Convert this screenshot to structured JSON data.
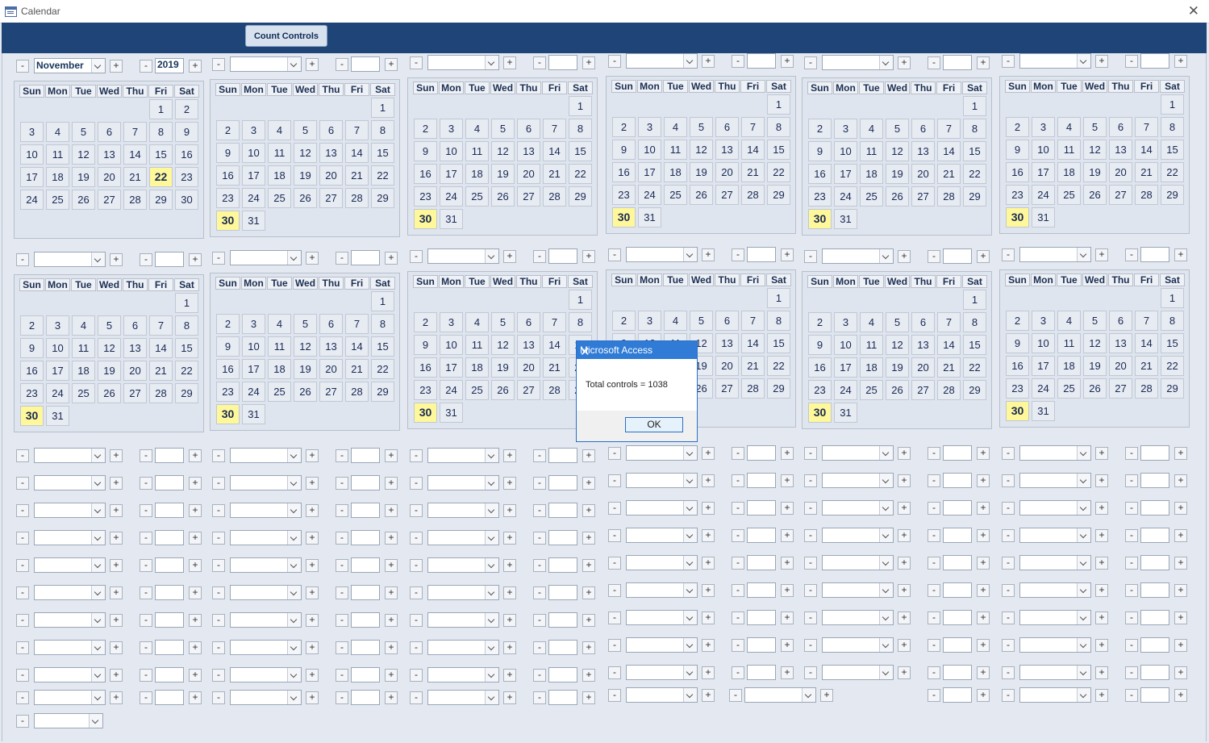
{
  "window": {
    "title": "Calendar",
    "close_glyph": "✕"
  },
  "toolbar": {
    "count_controls_label": "Count Controls"
  },
  "controls": {
    "minus_glyph": "-",
    "plus_glyph": "+"
  },
  "first_calendar": {
    "month": "November",
    "year": "2019",
    "today": "22"
  },
  "calendar": {
    "day_headers": [
      "Sun",
      "Mon",
      "Tue",
      "Wed",
      "Thu",
      "Fri",
      "Sat"
    ],
    "highlight_day": "30"
  },
  "calendars": [
    {
      "start": 5,
      "days": 30,
      "month": "November",
      "year": "2019",
      "today": 22
    },
    {
      "start": 6,
      "days": 31
    },
    {
      "start": 6,
      "days": 31
    },
    {
      "start": 6,
      "days": 31
    },
    {
      "start": 6,
      "days": 31
    },
    {
      "start": 6,
      "days": 31
    },
    {
      "start": 6,
      "days": 31
    },
    {
      "start": 6,
      "days": 31
    },
    {
      "start": 6,
      "days": 31
    },
    {
      "start": 6,
      "days": 31
    },
    {
      "start": 6,
      "days": 31
    },
    {
      "start": 6,
      "days": 31
    }
  ],
  "dialog": {
    "title": "Microsoft Access",
    "message": "Total controls = 1038",
    "ok_label": "OK",
    "close_glyph": "✕"
  }
}
